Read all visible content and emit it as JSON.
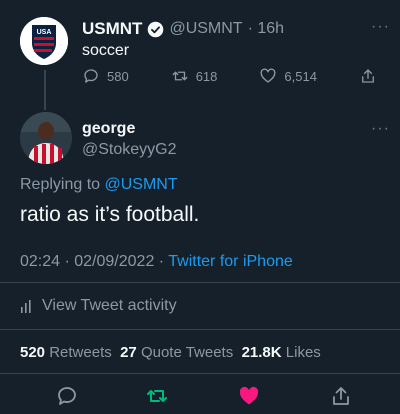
{
  "original_tweet": {
    "display_name": "USMNT",
    "handle": "@USMNT",
    "time": "· 16h",
    "text": "soccer",
    "avatar_text": "USA",
    "replies": "580",
    "retweets": "618",
    "likes": "6,514"
  },
  "reply": {
    "display_name": "george",
    "handle": "@StokeyyG2",
    "replying_prefix": "Replying to",
    "replying_to": "@USMNT",
    "text": "ratio as it’s football.",
    "timestamp": "02:24 · 02/09/2022 ·",
    "client": "Twitter for iPhone"
  },
  "activity": {
    "label": "View Tweet activity"
  },
  "stats": {
    "retweets_count": "520",
    "retweets_label": "Retweets",
    "quote_count": "27",
    "quote_label": "Quote Tweets",
    "likes_count": "21.8K",
    "likes_label": "Likes"
  },
  "colors": {
    "background": "#15202b",
    "accent": "#1d9bf0",
    "retweet": "#00ba7c",
    "like": "#f91880",
    "verified": "#1d9bf0"
  }
}
